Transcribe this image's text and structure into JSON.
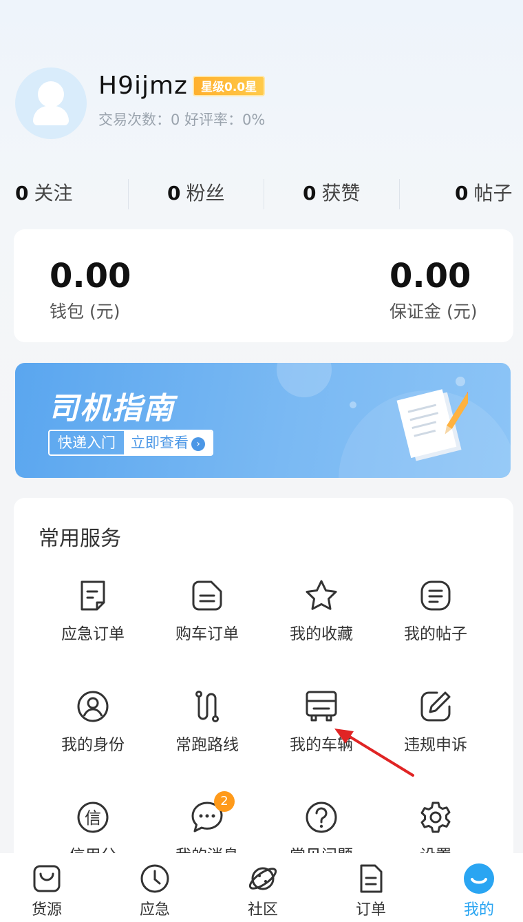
{
  "profile": {
    "username": "H9ijmz",
    "star_badge": "星级0.0星",
    "trade_info": "交易次数：0 好评率：0%"
  },
  "stats": [
    {
      "value": "0",
      "label": "关注"
    },
    {
      "value": "0",
      "label": "粉丝"
    },
    {
      "value": "0",
      "label": "获赞"
    },
    {
      "value": "0",
      "label": "帖子"
    }
  ],
  "wallet": {
    "wallet_value": "0.00",
    "wallet_label": "钱包 (元)",
    "deposit_value": "0.00",
    "deposit_label": "保证金 (元)"
  },
  "banner": {
    "title": "司机指南",
    "tag_left": "快递入门",
    "tag_right": "立即查看"
  },
  "services": {
    "title": "常用服务",
    "items": [
      {
        "label": "应急订单",
        "icon": "document-icon"
      },
      {
        "label": "购车订单",
        "icon": "receipt-icon"
      },
      {
        "label": "我的收藏",
        "icon": "star-icon"
      },
      {
        "label": "我的帖子",
        "icon": "list-icon"
      },
      {
        "label": "我的身份",
        "icon": "user-circle-icon"
      },
      {
        "label": "常跑路线",
        "icon": "route-icon"
      },
      {
        "label": "我的车辆",
        "icon": "truck-icon"
      },
      {
        "label": "违规申诉",
        "icon": "edit-icon"
      },
      {
        "label": "信用分",
        "icon": "credit-icon"
      },
      {
        "label": "我的消息",
        "icon": "chat-icon",
        "badge": "2"
      },
      {
        "label": "常见问题",
        "icon": "question-icon"
      },
      {
        "label": "设置",
        "icon": "gear-icon"
      }
    ]
  },
  "tabbar": {
    "items": [
      {
        "label": "货源",
        "icon": "bag-icon"
      },
      {
        "label": "应急",
        "icon": "clock-icon"
      },
      {
        "label": "社区",
        "icon": "planet-icon"
      },
      {
        "label": "订单",
        "icon": "order-icon"
      },
      {
        "label": "我的",
        "icon": "smile-icon",
        "active": true
      }
    ]
  },
  "colors": {
    "accent": "#2aa5f2",
    "badge": "#ff9a1a",
    "star_badge": "#ffb02e",
    "banner": "#5aa6ef",
    "annotation_arrow": "#e02424"
  }
}
